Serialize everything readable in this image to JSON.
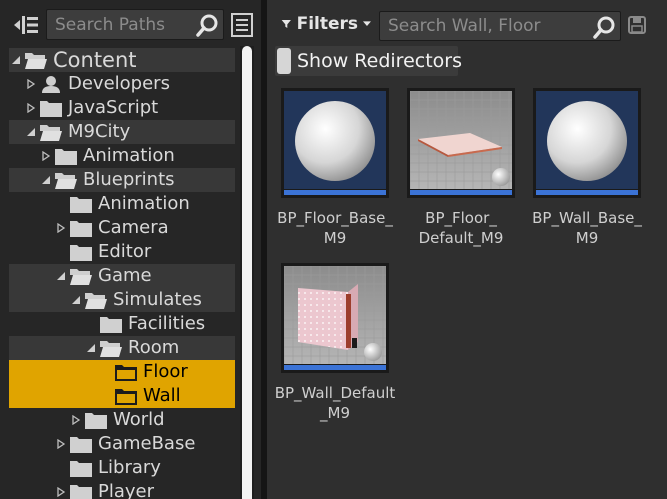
{
  "paths_panel": {
    "search_placeholder": "Search Paths",
    "tree": [
      {
        "label": "Content",
        "depth": 0,
        "expanded": true,
        "icon": "folder-open-icon",
        "root": true
      },
      {
        "label": "Developers",
        "depth": 1,
        "expanded": false,
        "icon": "user-icon"
      },
      {
        "label": "JavaScript",
        "depth": 1,
        "expanded": false,
        "icon": "folder-icon"
      },
      {
        "label": "M9City",
        "depth": 1,
        "expanded": true,
        "icon": "folder-open-icon"
      },
      {
        "label": "Animation",
        "depth": 2,
        "expanded": false,
        "icon": "folder-icon"
      },
      {
        "label": "Blueprints",
        "depth": 2,
        "expanded": true,
        "icon": "folder-open-icon"
      },
      {
        "label": "Animation",
        "depth": 3,
        "expanded": null,
        "icon": "folder-icon"
      },
      {
        "label": "Camera",
        "depth": 3,
        "expanded": false,
        "icon": "folder-icon"
      },
      {
        "label": "Editor",
        "depth": 3,
        "expanded": null,
        "icon": "folder-icon"
      },
      {
        "label": "Game",
        "depth": 3,
        "expanded": true,
        "icon": "folder-open-icon"
      },
      {
        "label": "Simulates",
        "depth": 4,
        "expanded": true,
        "icon": "folder-open-icon"
      },
      {
        "label": "Facilities",
        "depth": 5,
        "expanded": null,
        "icon": "folder-icon"
      },
      {
        "label": "Room",
        "depth": 5,
        "expanded": true,
        "icon": "folder-open-icon"
      },
      {
        "label": "Floor",
        "depth": 6,
        "expanded": null,
        "icon": "folder-icon",
        "selected": true
      },
      {
        "label": "Wall",
        "depth": 6,
        "expanded": null,
        "icon": "folder-icon",
        "selected": true
      },
      {
        "label": "World",
        "depth": 4,
        "expanded": false,
        "icon": "folder-icon"
      },
      {
        "label": "GameBase",
        "depth": 3,
        "expanded": false,
        "icon": "folder-icon"
      },
      {
        "label": "Library",
        "depth": 3,
        "expanded": null,
        "icon": "folder-icon"
      },
      {
        "label": "Player",
        "depth": 3,
        "expanded": false,
        "icon": "folder-icon"
      }
    ]
  },
  "content_panel": {
    "filters_label": "Filters",
    "search_placeholder": "Search Wall, Floor",
    "show_redirectors_label": "Show Redirectors",
    "assets": [
      {
        "name": "BP_Floor_Base_\nM9",
        "thumbnail": "sphere"
      },
      {
        "name": "BP_Floor_\nDefault_M9",
        "thumbnail": "floor-plane"
      },
      {
        "name": "BP_Wall_Base_\nM9",
        "thumbnail": "sphere"
      },
      {
        "name": "BP_Wall_Default\n_M9",
        "thumbnail": "wall-box"
      }
    ]
  },
  "colors": {
    "selection": "#e0a400",
    "asset_bar": "#3b73d6",
    "panel_bg": "#2f2f2f",
    "tree_bg": "#262626"
  }
}
